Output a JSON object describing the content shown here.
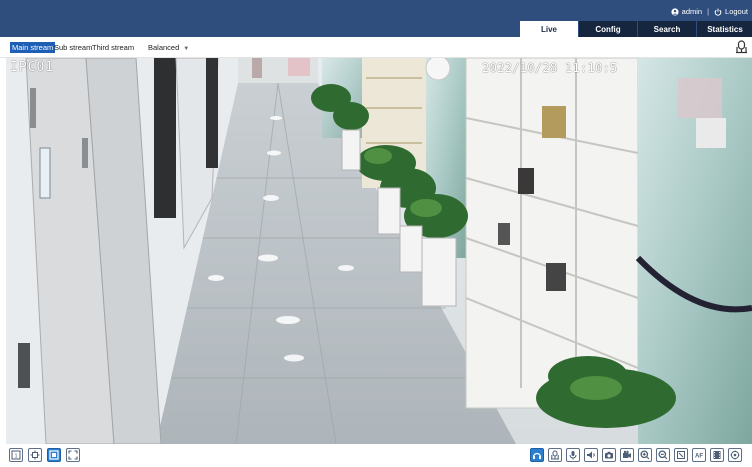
{
  "header": {
    "user": "admin",
    "logout_label": "Logout",
    "tabs": [
      {
        "label": "Live",
        "active": true
      },
      {
        "label": "Config",
        "active": false
      },
      {
        "label": "Search",
        "active": false
      },
      {
        "label": "Statistics",
        "active": false
      }
    ]
  },
  "stream_bar": {
    "streams": [
      {
        "label": "Main stream",
        "active": true
      },
      {
        "label": "Sub stream",
        "active": false
      },
      {
        "label": "Third stream",
        "active": false
      }
    ],
    "quality": "Balanced"
  },
  "video": {
    "osd_name": "IPC01",
    "osd_time": "2022/10/28 11:10:5"
  },
  "bottom_toolbar": {
    "left_icons": [
      "original-size-icon",
      "fit-window-icon",
      "stretch-icon",
      "fullscreen-icon"
    ],
    "right_icons": [
      "audio-icon",
      "talk-icon",
      "microphone-icon",
      "speaker-icon",
      "snapshot-icon",
      "record-icon",
      "zoom-in-icon",
      "zoom-out-icon",
      "3d-position-icon",
      "af-icon",
      "film-icon",
      "ptz-icon"
    ]
  },
  "colors": {
    "header": "#2f4e7e",
    "tab_bg": "#17263f",
    "accent": "#1e5fb6"
  }
}
